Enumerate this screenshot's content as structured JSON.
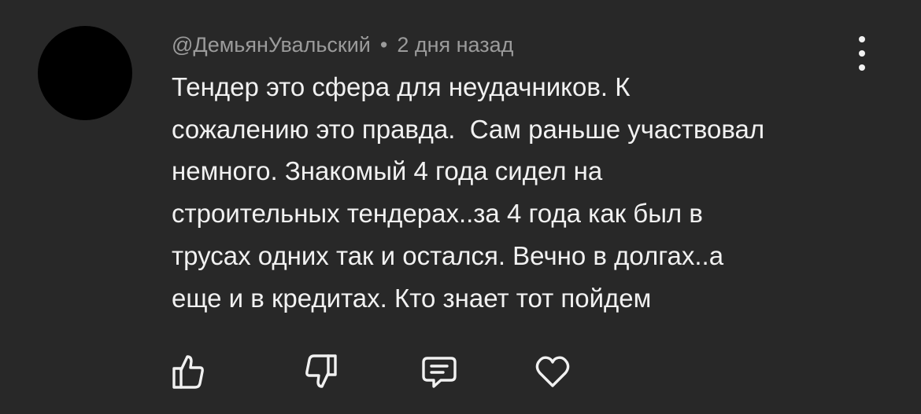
{
  "comment": {
    "author": "@ДемьянУвальский",
    "separator": "•",
    "timestamp": "2 дня назад",
    "text_lines": [
      "Тендер это сфера для неудачников. К",
      "сожалению это правда.  Сам раньше участвовал",
      "немного. Знакомый 4 года сидел на",
      "строительных тендерах..за 4 года как был в",
      "трусах одних так и остался. Вечно в долгах..а",
      "еще и в кредитах. Кто знает тот пойдем"
    ]
  },
  "actions": {
    "icons": [
      "thumbs-up-icon",
      "thumbs-down-icon",
      "reply-icon",
      "heart-icon",
      "more-vertical-icon"
    ]
  },
  "colors": {
    "background": "#282828",
    "text": "#f1f1f1",
    "meta": "#9b9b9b",
    "avatar": "#000000"
  }
}
